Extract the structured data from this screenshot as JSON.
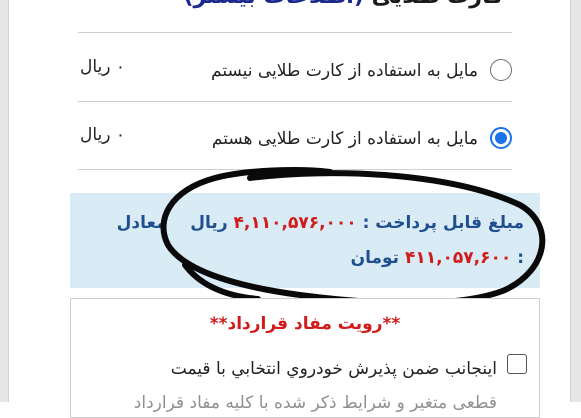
{
  "heading": {
    "title": "کارت طلایی",
    "more_link": "(اطلاعات بیشتر)"
  },
  "options": [
    {
      "label": "مایل به استفاده از کارت طلایی نیستم",
      "price": "۰ ریال",
      "checked": false
    },
    {
      "label": "مایل به استفاده از کارت طلایی هستم",
      "price": "۰ ریال",
      "checked": true
    }
  ],
  "payment": {
    "label": "مبلغ قابل پرداخت :",
    "amount_rial": "۴,۱۱۰,۵۷۶,۰۰۰",
    "rial": "ریال",
    "equivalent": "معادل",
    "colon": ":",
    "amount_toman": "۴۱۱,۰۵۷,۶۰۰",
    "toman": "تومان"
  },
  "contract": {
    "title": "**رویت مفاد قرارداد**",
    "agreement_text": "اینجانب ضمن پذیرش خودروي انتخابي با قیمت",
    "agreement_text_cont": "قطعی متغیر و شرایط ذکر شده با کلیه مفاد قرارداد"
  },
  "colors": {
    "accent": "#1a73e8",
    "info_bg": "#d9ebf5",
    "info_text": "#1f4f8f",
    "amount": "#d11b1b"
  }
}
